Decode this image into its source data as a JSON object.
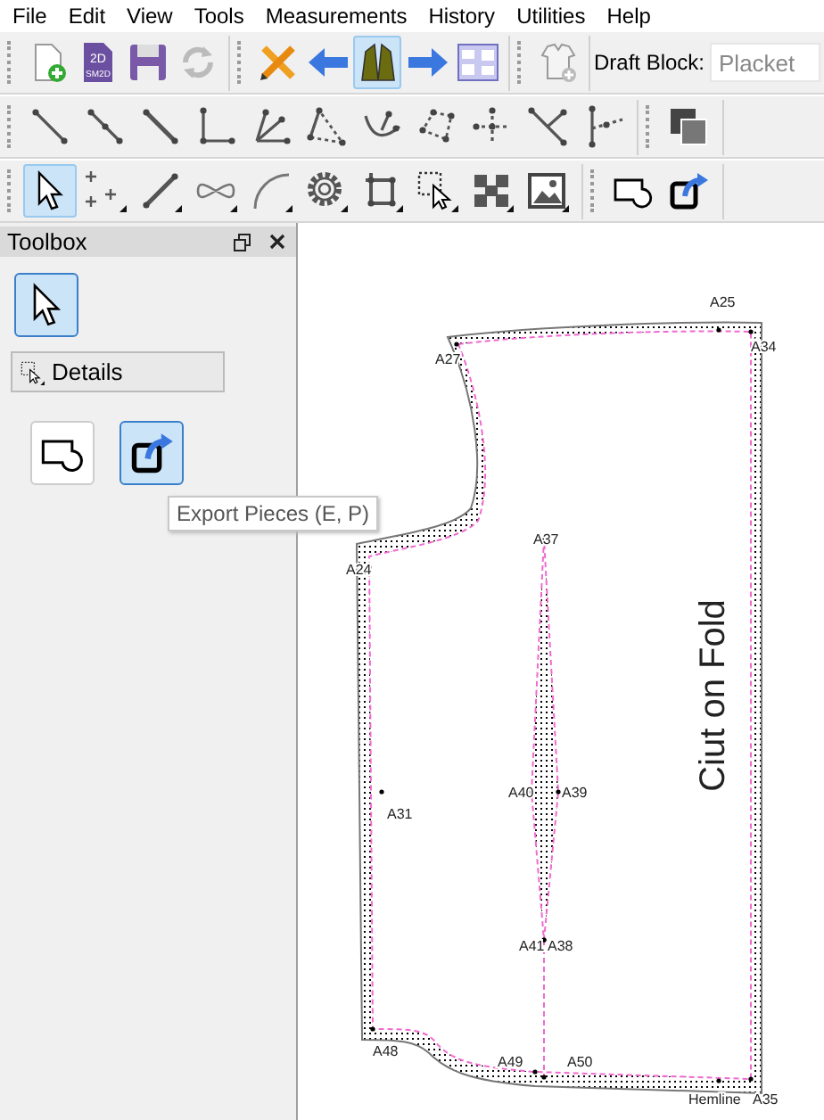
{
  "menu": [
    "File",
    "Edit",
    "View",
    "Tools",
    "Measurements",
    "History",
    "Utilities",
    "Help"
  ],
  "toolbars": [
    {
      "groups": [
        {
          "items": [
            {
              "kind": "new",
              "selected": false
            },
            {
              "kind": "document",
              "selected": false,
              "badge": "2D",
              "caption": "SM2D"
            },
            {
              "kind": "save",
              "selected": false
            },
            {
              "kind": "reload",
              "selected": false
            }
          ]
        },
        {
          "items": [
            {
              "kind": "pencil",
              "selected": false
            },
            {
              "kind": "left",
              "selected": false
            },
            {
              "kind": "dart",
              "selected": true
            },
            {
              "kind": "right",
              "selected": false
            },
            {
              "kind": "layout",
              "selected": false
            }
          ]
        },
        {
          "items": [
            {
              "kind": "shirt",
              "selected": false
            }
          ]
        }
      ],
      "draft_block": {
        "label": "Draft Block:",
        "value": "Placket"
      }
    },
    {
      "groups": [
        {
          "items": [
            {
              "kind": "endline",
              "selected": false
            },
            {
              "kind": "alongline",
              "selected": false
            },
            {
              "kind": "normal",
              "selected": false
            },
            {
              "kind": "shoulder",
              "selected": false
            },
            {
              "kind": "bisector",
              "selected": false
            },
            {
              "kind": "triangle",
              "selected": false
            },
            {
              "kind": "curvepoint",
              "selected": false
            },
            {
              "kind": "polygon",
              "selected": false
            },
            {
              "kind": "crosspoint",
              "selected": false
            },
            {
              "kind": "intersect",
              "selected": false
            },
            {
              "kind": "axis",
              "selected": false
            }
          ]
        },
        {
          "items": [
            {
              "kind": "layers",
              "selected": false
            }
          ]
        }
      ]
    },
    {
      "groups": [
        {
          "items": [
            {
              "kind": "pointer",
              "selected": true
            },
            {
              "kind": "points",
              "selected": false
            },
            {
              "kind": "line",
              "selected": false
            },
            {
              "kind": "curve",
              "selected": false
            },
            {
              "kind": "arc",
              "selected": false
            },
            {
              "kind": "gear",
              "selected": false
            },
            {
              "kind": "rect",
              "selected": false
            },
            {
              "kind": "select",
              "selected": false
            },
            {
              "kind": "group",
              "selected": false
            },
            {
              "kind": "image",
              "selected": false
            }
          ]
        },
        {
          "items": [
            {
              "kind": "piece",
              "selected": false
            },
            {
              "kind": "export",
              "selected": false
            }
          ]
        }
      ]
    }
  ],
  "toolbox": {
    "title": "Toolbox",
    "pointer": {
      "selected": true
    },
    "details": "Details",
    "tools": [
      {
        "kind": "piece",
        "selected": false
      },
      {
        "kind": "export",
        "selected": true
      }
    ],
    "tooltip": "Export Pieces (E, P)"
  },
  "canvas": {
    "points": [
      {
        "label": "A25"
      },
      {
        "label": "A27"
      },
      {
        "label": "A34"
      },
      {
        "label": "A24"
      },
      {
        "label": "A37"
      },
      {
        "label": "A31"
      },
      {
        "label": "A40"
      },
      {
        "label": "A39"
      },
      {
        "label": "A41"
      },
      {
        "label": "A38"
      },
      {
        "label": "A48"
      },
      {
        "label": "A49"
      },
      {
        "label": "A50"
      },
      {
        "label": "Hemline"
      },
      {
        "label": "A35"
      }
    ],
    "fold_text": "Ciut on Fold"
  }
}
